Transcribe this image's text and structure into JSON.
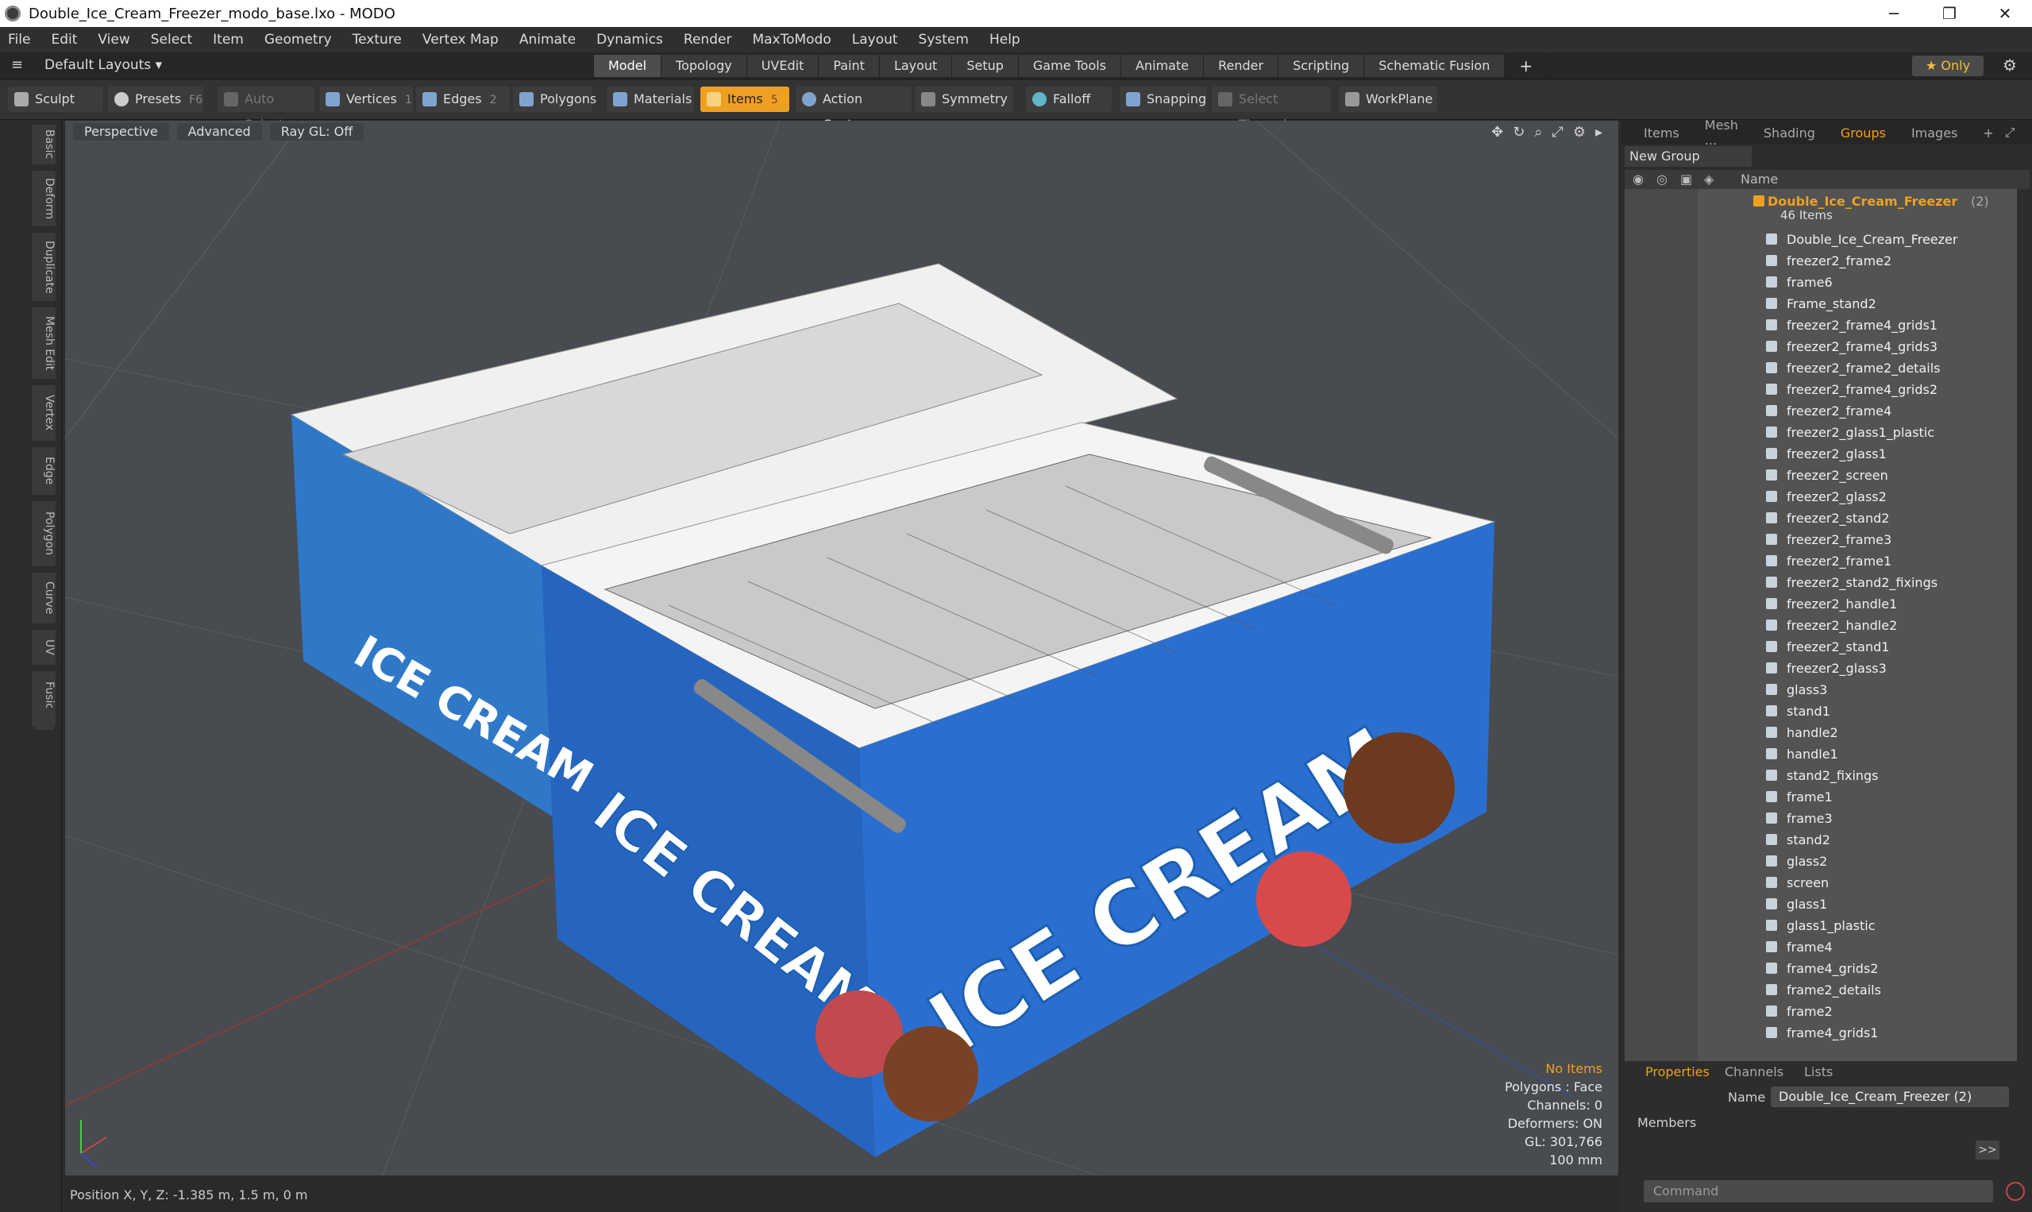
{
  "window": {
    "title": "Double_Ice_Cream_Freezer_modo_base.lxo - MODO",
    "min": "─",
    "max": "❐",
    "close": "✕"
  },
  "menu": [
    "File",
    "Edit",
    "View",
    "Select",
    "Item",
    "Geometry",
    "Texture",
    "Vertex Map",
    "Animate",
    "Dynamics",
    "Render",
    "MaxToModo",
    "Layout",
    "System",
    "Help"
  ],
  "layouts": {
    "label": "Default Layouts ▾",
    "tabs": [
      "Model",
      "Topology",
      "UVEdit",
      "Paint",
      "Layout",
      "Setup",
      "Game Tools",
      "Animate",
      "Render",
      "Scripting",
      "Schematic Fusion"
    ],
    "add": "+",
    "only": "★ Only"
  },
  "toolbar": {
    "sculpt": "Sculpt",
    "presets": "Presets",
    "presets_key": "F6",
    "auto_select": "Auto Select",
    "vertices": "Vertices",
    "vertices_key": "1",
    "edges": "Edges",
    "edges_key": "2",
    "polygons": "Polygons",
    "materials": "Materials",
    "items": "Items",
    "items_key": "5",
    "action_center": "Action Center",
    "symmetry": "Symmetry",
    "falloff": "Falloff",
    "snapping": "Snapping",
    "select_through": "Select Through",
    "workplane": "WorkPlane"
  },
  "side_tabs": [
    "Basic",
    "Deform",
    "Duplicate",
    "Mesh Edit",
    "Vertex",
    "Edge",
    "Polygon",
    "Curve",
    "UV",
    "Fusion"
  ],
  "viewport": {
    "perspective": "Perspective",
    "advanced": "Advanced",
    "raygl": "Ray GL: Off",
    "status": [
      "No Items",
      "Polygons : Face",
      "Channels: 0",
      "Deformers: ON",
      "GL: 301,766",
      "100 mm"
    ],
    "image_text_1": "ICE CREAM"
  },
  "position": "Position X, Y, Z:   -1.385 m, 1.5 m, 0 m",
  "panel": {
    "tabs": [
      "Items",
      "Mesh ...",
      "Shading",
      "Groups",
      "Images"
    ],
    "active_tab": "Groups",
    "new_group": "New Group",
    "col_name": "Name",
    "group_name": "Double_Ice_Cream_Freezer",
    "group_count": "(2)",
    "item_count": "46 Items",
    "items": [
      "Double_Ice_Cream_Freezer",
      "freezer2_frame2",
      "frame6",
      "Frame_stand2",
      "freezer2_frame4_grids1",
      "freezer2_frame4_grids3",
      "freezer2_frame2_details",
      "freezer2_frame4_grids2",
      "freezer2_frame4",
      "freezer2_glass1_plastic",
      "freezer2_glass1",
      "freezer2_screen",
      "freezer2_glass2",
      "freezer2_stand2",
      "freezer2_frame3",
      "freezer2_frame1",
      "freezer2_stand2_fixings",
      "freezer2_handle1",
      "freezer2_handle2",
      "freezer2_stand1",
      "freezer2_glass3",
      "glass3",
      "stand1",
      "handle2",
      "handle1",
      "stand2_fixings",
      "frame1",
      "frame3",
      "stand2",
      "glass2",
      "screen",
      "glass1",
      "glass1_plastic",
      "frame4",
      "frame4_grids2",
      "frame2_details",
      "frame2",
      "frame4_grids1"
    ]
  },
  "properties": {
    "tabs": [
      "Properties",
      "Channels",
      "Lists"
    ],
    "name_label": "Name",
    "name_value": "Double_Ice_Cream_Freezer (2)",
    "members": "Members",
    "arrow": ">>",
    "command": "Command"
  }
}
